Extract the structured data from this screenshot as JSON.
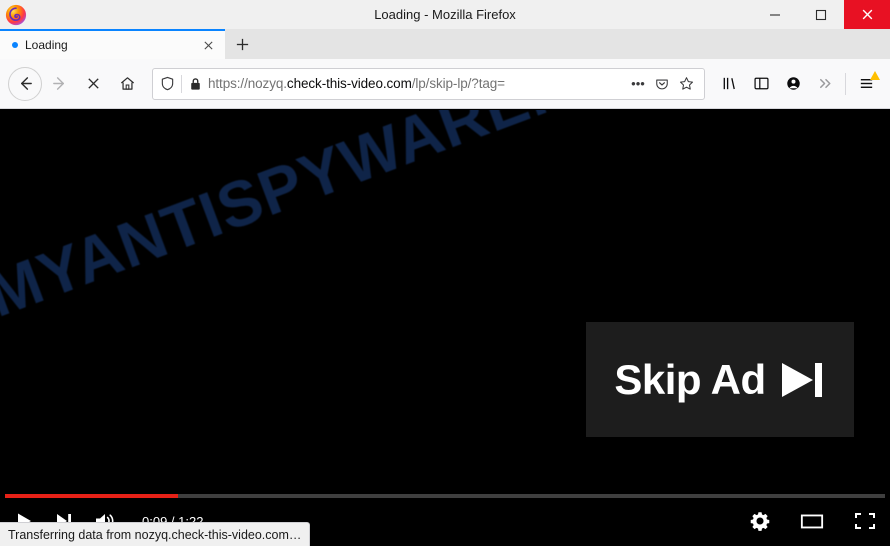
{
  "window": {
    "title": "Loading - Mozilla Firefox",
    "logo_icon": "firefox-logo",
    "minimize_label": "—",
    "maximize_label": "☐",
    "close_label": "✕"
  },
  "tabs": {
    "items": [
      {
        "label": "Loading",
        "loading": true,
        "close_label": "✕"
      }
    ],
    "new_tab_label": "+"
  },
  "nav": {
    "back_icon": "back-arrow-icon",
    "back_label": "←",
    "forward_icon": "forward-arrow-icon",
    "forward_label": "→",
    "stop_icon": "stop-loading-icon",
    "stop_label": "✕",
    "home_icon": "home-icon"
  },
  "urlbar": {
    "shield_icon": "tracking-protection-shield-icon",
    "lock_icon": "padlock-icon",
    "scheme": "https://",
    "subdomain": "nozyq.",
    "domain": "check-this-video.com",
    "path": "/lp/skip-lp/?tag=",
    "full_url": "https://nozyq.check-this-video.com/lp/skip-lp/?tag=",
    "page_actions_icon": "ellipsis-icon",
    "page_actions_label": "•••",
    "pocket_icon": "pocket-save-icon",
    "bookmark_icon": "bookmark-star-icon",
    "bookmark_label": "☆"
  },
  "toolbar": {
    "library_icon": "library-icon",
    "sidebar_icon": "sidebar-toggle-icon",
    "account_icon": "account-sync-icon",
    "overflow_icon": "overflow-chevrons-icon",
    "overflow_label": "»",
    "menu_icon": "hamburger-menu-icon",
    "menu_has_warning_badge": true
  },
  "page": {
    "watermark_text": "MYANTISPYWARE.COM",
    "watermark_color": "#0f2448",
    "background_color": "#000000",
    "skip_ad": {
      "label": "Skip Ad",
      "icon": "skip-next-icon",
      "background_color": "#1d1d1d",
      "text_color": "#ffffff"
    }
  },
  "player": {
    "progress_percent": 19.7,
    "progress_color": "#e62117",
    "play_icon": "play-icon",
    "next_icon": "next-video-icon",
    "volume_icon": "volume-icon",
    "current_time": "0:09",
    "duration": "1:22",
    "timecode": "0:09 / 1:22",
    "settings_icon": "gear-icon",
    "theater_icon": "theater-mode-icon",
    "fullscreen_icon": "fullscreen-icon"
  },
  "statusbar": {
    "text": "Transferring data from nozyq.check-this-video.com…"
  }
}
